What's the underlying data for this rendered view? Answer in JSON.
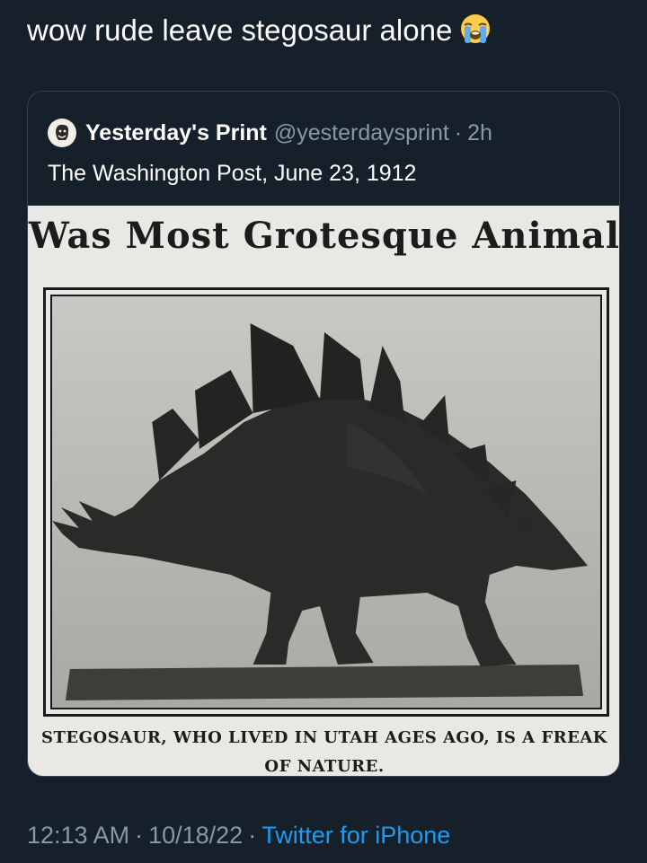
{
  "tweet": {
    "text": "wow rude leave stegosaur alone",
    "emoji": "loudly-crying-face-emoji"
  },
  "quoted_tweet": {
    "display_name": "Yesterday's Print",
    "handle": "@yesterdaysprint",
    "separator": "·",
    "time_ago": "2h",
    "text": "The Washington Post, June 23, 1912",
    "avatar_icon": "portrait-avatar-icon",
    "clipping": {
      "headline": "Was Most Grotesque Animal",
      "caption_line1": "STEGOSAUR, WHO LIVED IN UTAH AGES AGO, IS A FREAK",
      "caption_line2": "OF NATURE."
    }
  },
  "meta": {
    "time": "12:13 AM",
    "separator": "·",
    "date": "10/18/22",
    "source": "Twitter for iPhone"
  },
  "colors": {
    "background": "#15202b",
    "primary_text": "#ffffff",
    "secondary_text": "#8899a6",
    "link": "#1d9bf0",
    "card_border": "#38444d",
    "newsprint": "#e9e8e4"
  }
}
